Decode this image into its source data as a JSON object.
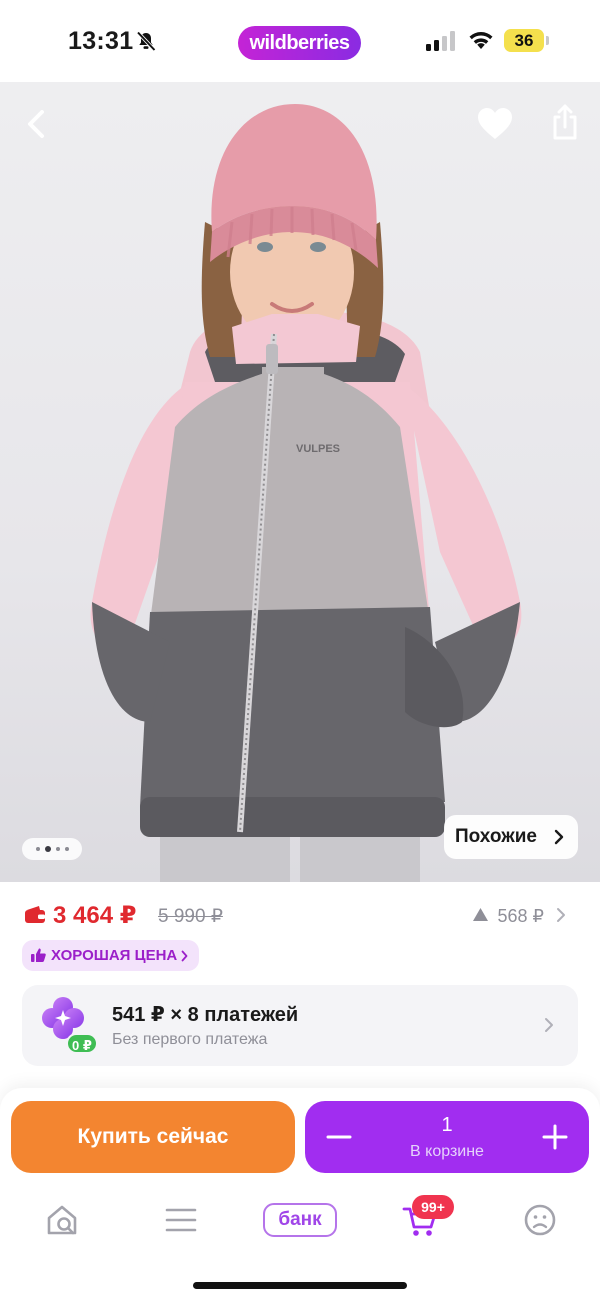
{
  "status_bar": {
    "time": "13:31",
    "brand": "wildberries",
    "battery": "36",
    "icons": [
      "bell-muted-icon",
      "signal-icon",
      "wifi-icon",
      "battery-icon"
    ]
  },
  "product_photo": {
    "image_label_text": "VULPES",
    "similar_button": "Похожие",
    "pager": {
      "count": 4,
      "active": 2
    },
    "icons": [
      "back-icon",
      "heart-icon",
      "share-icon"
    ]
  },
  "price": {
    "current": "3 464 ₽",
    "old": "5 990 ₽",
    "dynamics": "568 ₽",
    "current_color": "#e0292f"
  },
  "badge": {
    "good_price": "ХОРОШАЯ ЦЕНА"
  },
  "installment": {
    "title": "541 ₽ × 8 платежей",
    "subtitle": "Без первого платежа",
    "zero_badge": "0 ₽"
  },
  "actions": {
    "buy_now": "Купить сейчас",
    "quantity": "1",
    "in_cart": "В корзине",
    "buy_color": "#f38530",
    "cart_color": "#a12df0"
  },
  "tab_bar": {
    "items": [
      "home",
      "catalog",
      "bank",
      "cart",
      "profile"
    ],
    "bank_label": "банк",
    "cart_badge": "99+"
  }
}
